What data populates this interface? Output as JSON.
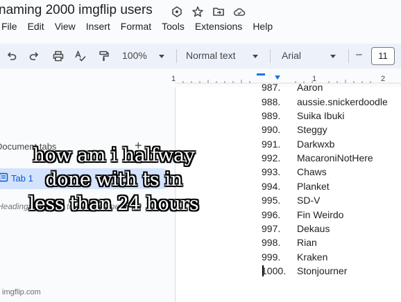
{
  "window": {
    "doc_title": "naming 2000 imgflip users",
    "icons": [
      "star-icon",
      "move-to-folder-icon",
      "cloud-saved-icon",
      "tag-icon"
    ]
  },
  "menubar": {
    "items": [
      "File",
      "Edit",
      "View",
      "Insert",
      "Format",
      "Tools",
      "Extensions",
      "Help"
    ]
  },
  "toolbar": {
    "zoom": "100%",
    "style": "Normal text",
    "font": "Arial",
    "minus": "–",
    "font_size": "11"
  },
  "ruler": {
    "labels": [
      "1",
      "1",
      "2"
    ]
  },
  "sidebar": {
    "heading": "Document tabs",
    "plus": "+",
    "tab_label": "Tab 1",
    "note": "Headings you add to the document"
  },
  "list": [
    {
      "num": "987.",
      "name": "Aaron"
    },
    {
      "num": "988.",
      "name": "aussie.snickerdoodle"
    },
    {
      "num": "989.",
      "name": "Suika Ibuki"
    },
    {
      "num": "990.",
      "name": "Steggy"
    },
    {
      "num": "991.",
      "name": "Darkwxb"
    },
    {
      "num": "992.",
      "name": "MacaroniNotHere"
    },
    {
      "num": "993.",
      "name": "Chaws"
    },
    {
      "num": "994.",
      "name": "Planket"
    },
    {
      "num": "995.",
      "name": "SD-V"
    },
    {
      "num": "996.",
      "name": "Fin Weirdo"
    },
    {
      "num": "997.",
      "name": "Dekaus"
    },
    {
      "num": "998.",
      "name": "Rian"
    },
    {
      "num": "999.",
      "name": "Kraken"
    },
    {
      "num": "1000.",
      "name": "Stonjourner"
    }
  ],
  "meme_caption": {
    "line1": "how am i halfway",
    "line2": "done with ts in",
    "line3": "less than 24 hours"
  },
  "watermark": "imgflip.com",
  "colors": {
    "toolbar_bg": "#edf2fa",
    "tab_selected": "#d3e3fd",
    "ruler_marker": "#1a73e8"
  }
}
